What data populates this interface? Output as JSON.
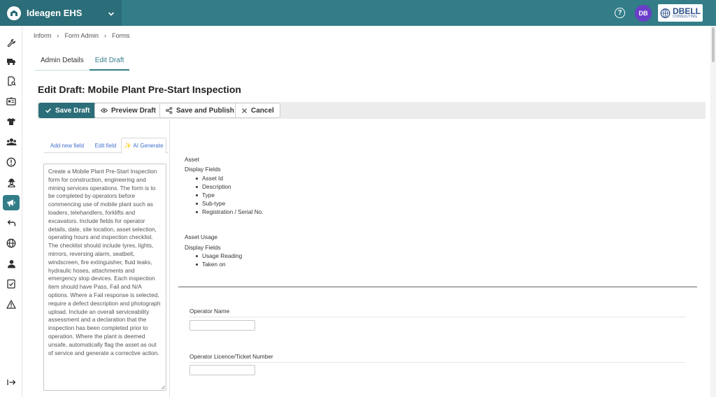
{
  "app": {
    "name": "Ideagen EHS",
    "user_initials": "DB",
    "company_logo_main": "DBELL",
    "company_logo_sub": "CONSULTING",
    "help_label": "?",
    "accent_color": "#327d88",
    "avatar_color": "#6a3fc8"
  },
  "sidebar": {
    "icons": [
      "wrench-icon",
      "truck-icon",
      "document-search-icon",
      "id-card-icon",
      "shirt-icon",
      "group-icon",
      "alert-circle-icon",
      "worker-icon",
      "megaphone-icon",
      "undo-icon",
      "globe-icon",
      "person-icon",
      "checklist-icon",
      "warning-icon",
      "collapse-icon"
    ],
    "active_icon": "megaphone-icon"
  },
  "breadcrumb": [
    "Inform",
    "Form Admin",
    "Forms"
  ],
  "tabs": [
    {
      "label": "Admin Details"
    },
    {
      "label": "Edit Draft"
    }
  ],
  "active_tab": "Edit Draft",
  "page_title": "Edit Draft: Mobile Plant Pre-Start Inspection",
  "toolbar": {
    "save_draft": "Save Draft",
    "preview_draft": "Preview Draft",
    "save_publish": "Save and Publish",
    "cancel": "Cancel"
  },
  "field_tabs": {
    "add_new_field": "Add new field",
    "edit_field": "Edit field",
    "ai_generate": "AI Generate"
  },
  "ai_prompt": "Create a Mobile Plant Pre-Start Inspection form for construction, engineering and mining services operations. The form is to be completed by operators before commencing use of mobile plant such as loaders, telehandlers, forklifts and excavators. Include fields for operator details, date, site location, asset selection, operating hours and inspection checklist. The checklist should include tyres, lights, mirrors, reversing alarm, seatbelt, windscreen, fire extinguisher, fluid leaks, hydraulic hoses, attachments and emergency stop devices. Each inspection item should have Pass, Fail and N/A options. Where a Fail response is selected, require a defect description and photograph upload. Include an overall serviceability assessment and a declaration that the inspection has been completed prior to operation. Where the plant is deemed unsafe, automatically flag the asset as out of service and generate a corrective action.",
  "preview": {
    "asset": {
      "title": "Asset",
      "display_fields_label": "Display Fields",
      "fields": [
        "Asset Id",
        "Description",
        "Type",
        "Sub-type",
        "Registration / Serial No."
      ]
    },
    "asset_usage": {
      "title": "Asset Usage",
      "display_fields_label": "Display Fields",
      "fields": [
        "Usage Reading",
        "Taken on"
      ]
    },
    "operator_name_label": "Operator Name",
    "operator_name_value": "",
    "operator_licence_label": "Operator Licence/Ticket Number",
    "operator_licence_value": ""
  }
}
